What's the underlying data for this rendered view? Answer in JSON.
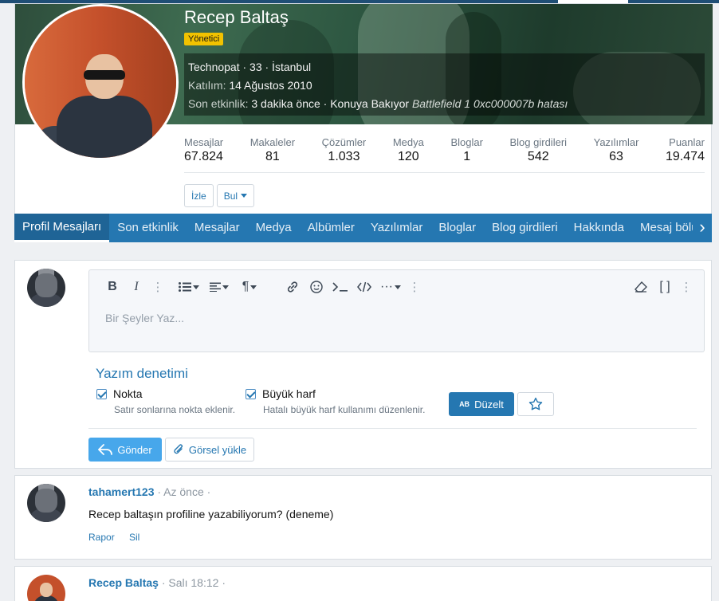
{
  "profile": {
    "username": "Recep Baltaş",
    "role_badge": "Yönetici",
    "title_line": "Technopat · 33 · İstanbul",
    "joined_label": "Katılım:",
    "joined_value": "14 Ağustos 2010",
    "last_activity_label": "Son etkinlik:",
    "last_activity_value": "3 dakika önce · Konuya Bakıyor",
    "last_activity_thread": "Battlefield 1 0xc000007b hatası",
    "stats": [
      {
        "label": "Mesajlar",
        "value": "67.824"
      },
      {
        "label": "Makaleler",
        "value": "81"
      },
      {
        "label": "Çözümler",
        "value": "1.033"
      },
      {
        "label": "Medya",
        "value": "120"
      },
      {
        "label": "Bloglar",
        "value": "1"
      },
      {
        "label": "Blog girdileri",
        "value": "542"
      },
      {
        "label": "Yazılımlar",
        "value": "63"
      },
      {
        "label": "Puanlar",
        "value": "19.474"
      }
    ],
    "follow_button": "İzle",
    "find_button": "Bul"
  },
  "tabs": [
    "Profil Mesajları",
    "Son etkinlik",
    "Mesajlar",
    "Medya",
    "Albümler",
    "Yazılımlar",
    "Bloglar",
    "Blog girdileri",
    "Hakkında",
    "Mesaj bölü"
  ],
  "editor": {
    "placeholder": "Bir Şeyler Yaz...",
    "toolbar": {
      "bold": "B",
      "italic": "I"
    },
    "spellcheck_title": "Yazım denetimi",
    "spell_options": [
      {
        "label": "Nokta",
        "desc": "Satır sonlarına nokta eklenir."
      },
      {
        "label": "Büyük harf",
        "desc": "Hatalı büyük harf kullanımı düzenlenir."
      }
    ],
    "fix_button": "Düzelt",
    "fix_icon_text": "AB",
    "send_button": "Gönder",
    "upload_button": "Görsel yükle"
  },
  "messages": [
    {
      "author": "tahamert123",
      "time": "· Az önce ·",
      "text": "Recep baltaşın profiline yazabiliyorum? (deneme)",
      "actions": [
        "Rapor",
        "Sil"
      ]
    },
    {
      "author": "Recep Baltaş",
      "time": "· Salı 18:12 ·",
      "text": ""
    }
  ],
  "colors": {
    "accent": "#2577b1",
    "send_button": "#47a7eb",
    "badge": "#f2c200"
  }
}
